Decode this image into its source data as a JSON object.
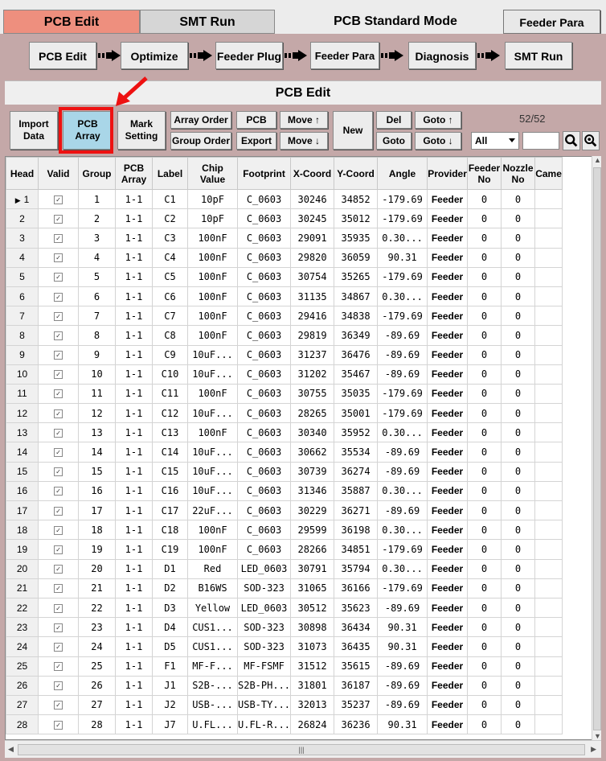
{
  "tabs": {
    "pcb_edit": "PCB Edit",
    "smt_run": "SMT Run"
  },
  "mode_title": "PCB Standard Mode",
  "feeder_para_button": "Feeder Para",
  "flow": [
    "PCB Edit",
    "Optimize",
    "Feeder Plug",
    "Feeder Para",
    "Diagnosis",
    "SMT Run"
  ],
  "section_title": "PCB Edit",
  "toolbar": {
    "import_data": [
      "Import",
      "Data"
    ],
    "pcb_array": [
      "PCB",
      "Array"
    ],
    "mark_setting": [
      "Mark",
      "Setting"
    ],
    "array_order": "Array Order",
    "group_order": "Group Order",
    "pcb": "PCB",
    "export": "Export",
    "move_up": "Move ↑",
    "move_down": "Move ↓",
    "new": "New",
    "del": "Del",
    "goto": "Goto",
    "goto_up": "Goto ↑",
    "goto_down": "Goto ↓",
    "counter": "52/52",
    "filter_value": "All"
  },
  "columns": [
    "Head",
    "Valid",
    "Group",
    "PCB Array",
    "Label",
    "Chip Value",
    "Footprint",
    "X-Coord",
    "Y-Coord",
    "Angle",
    "Provider",
    "Feeder No",
    "Nozzle No",
    "Came"
  ],
  "rows": [
    [
      "1",
      "1",
      "1-1",
      "C1",
      "10pF",
      "C_0603",
      "30246",
      "34852",
      "-179.69",
      "Feeder",
      "0",
      "0"
    ],
    [
      "2",
      "2",
      "1-1",
      "C2",
      "10pF",
      "C_0603",
      "30245",
      "35012",
      "-179.69",
      "Feeder",
      "0",
      "0"
    ],
    [
      "3",
      "3",
      "1-1",
      "C3",
      "100nF",
      "C_0603",
      "29091",
      "35935",
      "0.30...",
      "Feeder",
      "0",
      "0"
    ],
    [
      "4",
      "4",
      "1-1",
      "C4",
      "100nF",
      "C_0603",
      "29820",
      "36059",
      "90.31",
      "Feeder",
      "0",
      "0"
    ],
    [
      "5",
      "5",
      "1-1",
      "C5",
      "100nF",
      "C_0603",
      "30754",
      "35265",
      "-179.69",
      "Feeder",
      "0",
      "0"
    ],
    [
      "6",
      "6",
      "1-1",
      "C6",
      "100nF",
      "C_0603",
      "31135",
      "34867",
      "0.30...",
      "Feeder",
      "0",
      "0"
    ],
    [
      "7",
      "7",
      "1-1",
      "C7",
      "100nF",
      "C_0603",
      "29416",
      "34838",
      "-179.69",
      "Feeder",
      "0",
      "0"
    ],
    [
      "8",
      "8",
      "1-1",
      "C8",
      "100nF",
      "C_0603",
      "29819",
      "36349",
      "-89.69",
      "Feeder",
      "0",
      "0"
    ],
    [
      "9",
      "9",
      "1-1",
      "C9",
      "10uF...",
      "C_0603",
      "31237",
      "36476",
      "-89.69",
      "Feeder",
      "0",
      "0"
    ],
    [
      "10",
      "10",
      "1-1",
      "C10",
      "10uF...",
      "C_0603",
      "31202",
      "35467",
      "-89.69",
      "Feeder",
      "0",
      "0"
    ],
    [
      "11",
      "11",
      "1-1",
      "C11",
      "100nF",
      "C_0603",
      "30755",
      "35035",
      "-179.69",
      "Feeder",
      "0",
      "0"
    ],
    [
      "12",
      "12",
      "1-1",
      "C12",
      "10uF...",
      "C_0603",
      "28265",
      "35001",
      "-179.69",
      "Feeder",
      "0",
      "0"
    ],
    [
      "13",
      "13",
      "1-1",
      "C13",
      "100nF",
      "C_0603",
      "30340",
      "35952",
      "0.30...",
      "Feeder",
      "0",
      "0"
    ],
    [
      "14",
      "14",
      "1-1",
      "C14",
      "10uF...",
      "C_0603",
      "30662",
      "35534",
      "-89.69",
      "Feeder",
      "0",
      "0"
    ],
    [
      "15",
      "15",
      "1-1",
      "C15",
      "10uF...",
      "C_0603",
      "30739",
      "36274",
      "-89.69",
      "Feeder",
      "0",
      "0"
    ],
    [
      "16",
      "16",
      "1-1",
      "C16",
      "10uF...",
      "C_0603",
      "31346",
      "35887",
      "0.30...",
      "Feeder",
      "0",
      "0"
    ],
    [
      "17",
      "17",
      "1-1",
      "C17",
      "22uF...",
      "C_0603",
      "30229",
      "36271",
      "-89.69",
      "Feeder",
      "0",
      "0"
    ],
    [
      "18",
      "18",
      "1-1",
      "C18",
      "100nF",
      "C_0603",
      "29599",
      "36198",
      "0.30...",
      "Feeder",
      "0",
      "0"
    ],
    [
      "19",
      "19",
      "1-1",
      "C19",
      "100nF",
      "C_0603",
      "28266",
      "34851",
      "-179.69",
      "Feeder",
      "0",
      "0"
    ],
    [
      "20",
      "20",
      "1-1",
      "D1",
      "Red",
      "LED_0603",
      "30791",
      "35794",
      "0.30...",
      "Feeder",
      "0",
      "0"
    ],
    [
      "21",
      "21",
      "1-1",
      "D2",
      "B16WS",
      "SOD-323",
      "31065",
      "36166",
      "-179.69",
      "Feeder",
      "0",
      "0"
    ],
    [
      "22",
      "22",
      "1-1",
      "D3",
      "Yellow",
      "LED_0603",
      "30512",
      "35623",
      "-89.69",
      "Feeder",
      "0",
      "0"
    ],
    [
      "23",
      "23",
      "1-1",
      "D4",
      "CUS1...",
      "SOD-323",
      "30898",
      "36434",
      "90.31",
      "Feeder",
      "0",
      "0"
    ],
    [
      "24",
      "24",
      "1-1",
      "D5",
      "CUS1...",
      "SOD-323",
      "31073",
      "36435",
      "90.31",
      "Feeder",
      "0",
      "0"
    ],
    [
      "25",
      "25",
      "1-1",
      "F1",
      "MF-F...",
      "MF-FSMF",
      "31512",
      "35615",
      "-89.69",
      "Feeder",
      "0",
      "0"
    ],
    [
      "26",
      "26",
      "1-1",
      "J1",
      "S2B-...",
      "S2B-PH...",
      "31801",
      "36187",
      "-89.69",
      "Feeder",
      "0",
      "0"
    ],
    [
      "27",
      "27",
      "1-1",
      "J2",
      "USB-...",
      "USB-TY...",
      "32013",
      "35237",
      "-89.69",
      "Feeder",
      "0",
      "0"
    ],
    [
      "28",
      "28",
      "1-1",
      "J7",
      "U.FL...",
      "U.FL-R...",
      "26824",
      "36236",
      "90.31",
      "Feeder",
      "0",
      "0"
    ]
  ],
  "scroll_grip": "|||"
}
